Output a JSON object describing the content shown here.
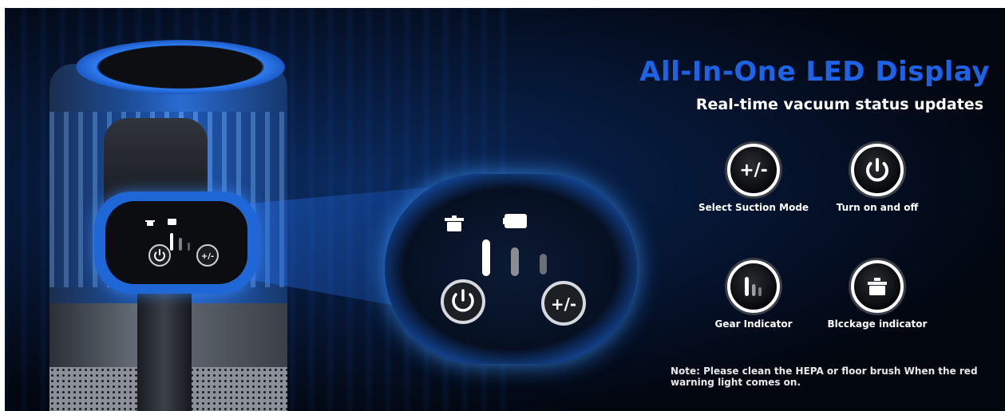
{
  "headline": "All-In-One LED Display",
  "subheadline": "Real-time vacuum status updates",
  "features": [
    {
      "icon": "plus-minus-icon",
      "label": "Select Suction Mode"
    },
    {
      "icon": "power-icon",
      "label": "Turn on and off"
    },
    {
      "icon": "gear-bars-icon",
      "label": "Gear Indicator"
    },
    {
      "icon": "blockage-icon",
      "label": "Blcckage indicator"
    }
  ],
  "note": "Note: Please clean the HEPA or floor brush When the red warning light comes on.",
  "button_labels": {
    "plus_minus": "+/-"
  },
  "colors": {
    "accent_blue": "#1e63e6",
    "glow_blue": "#2e7bf0",
    "background": "#02060f",
    "text": "#ffffff"
  }
}
